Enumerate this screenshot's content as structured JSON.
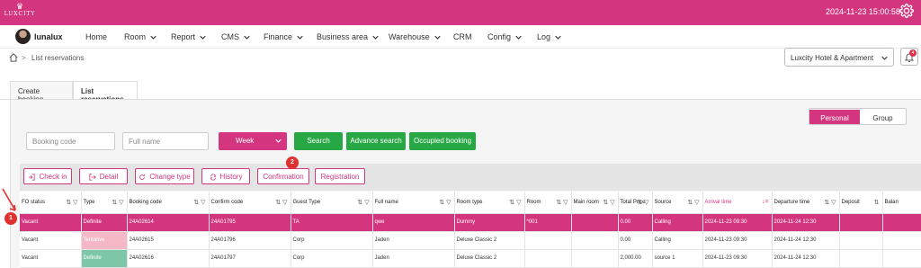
{
  "brand": {
    "logo_text": "LUXCITY",
    "color": "#d4357f"
  },
  "header": {
    "clock": "2024-11-23 15:00:58",
    "settings_icon": "gear-icon"
  },
  "user": {
    "name": "lunalux"
  },
  "menu": [
    {
      "label": "Home",
      "dropdown": false
    },
    {
      "label": "Room",
      "dropdown": true
    },
    {
      "label": "Report",
      "dropdown": true
    },
    {
      "label": "CMS",
      "dropdown": true
    },
    {
      "label": "Finance",
      "dropdown": true
    },
    {
      "label": "Business area",
      "dropdown": true
    },
    {
      "label": "Warehouse",
      "dropdown": true
    },
    {
      "label": "CRM",
      "dropdown": false
    },
    {
      "label": "Config",
      "dropdown": true
    },
    {
      "label": "Log",
      "dropdown": true
    }
  ],
  "breadcrumb": {
    "current": "List reservations"
  },
  "hotel_selector": {
    "value": "Luxcity Hotel & Apartment"
  },
  "notifications": {
    "count": "4"
  },
  "tabs": [
    {
      "label": "Create booking",
      "active": false
    },
    {
      "label": "List reservations",
      "active": true
    }
  ],
  "view_toggle": {
    "personal": "Personal",
    "group": "Group"
  },
  "filters": {
    "booking_code_placeholder": "Booking code",
    "full_name_placeholder": "Full name",
    "period": "Week",
    "search": "Search",
    "advance_search": "Advance search",
    "occupied_booking": "Occupied booking"
  },
  "actions": {
    "check_in": "Check in",
    "detail": "Detail",
    "change_type": "Change type",
    "history": "History",
    "confirmation": "Confirmation",
    "registration": "Registration"
  },
  "markers": {
    "one": "1",
    "two": "2"
  },
  "table": {
    "columns": [
      "FO status",
      "Type",
      "Booking code",
      "Confirm code",
      "Guest Type",
      "Full name",
      "Room type",
      "Room",
      "Main room",
      "Total Price",
      "Source",
      "Arrival time",
      "Departure time",
      "Deposit",
      "Balan"
    ],
    "rows": [
      [
        "Vacant",
        "Definite",
        "24A02614",
        "24A01795",
        "TA",
        "qwe",
        "Dummy",
        "*001",
        "",
        "0.00",
        "Calling",
        "2024-11-23 09:30",
        "2024-11-24 12:30",
        "",
        ""
      ],
      [
        "Vacant",
        "Tentative",
        "24A02615",
        "24A01796",
        "Corp",
        "Jaden",
        "Deluxe Classic 2",
        "",
        "",
        "0.00",
        "Calling",
        "2024-11-23 09:30",
        "2024-11-24 12:30",
        "",
        ""
      ],
      [
        "Vacant",
        "Definite",
        "24A02616",
        "24A01797",
        "Corp",
        "Jaden",
        "Deluxe Classic 2",
        "",
        "",
        "2,000.00",
        "source 1",
        "2024-11-23 09:30",
        "2024-11-24 12:30",
        "",
        ""
      ]
    ]
  }
}
